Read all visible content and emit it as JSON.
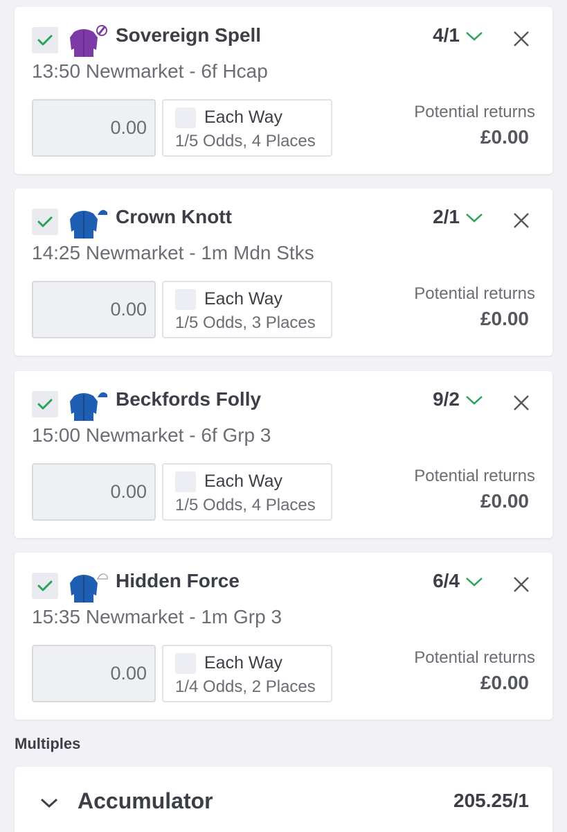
{
  "colors": {
    "accent_green": "#2aa35a",
    "silk_purple": "#7d3aa6",
    "silk_blue": "#1f5fb3"
  },
  "selections": [
    {
      "name": "Sovereign Spell",
      "odds": "4/1",
      "race": "13:50 Newmarket - 6f Hcap",
      "stake": "0.00",
      "each_way_label": "Each Way",
      "each_way_terms": "1/5 Odds, 4 Places",
      "returns_label": "Potential returns",
      "returns_value": "£0.00",
      "silk": "purple-silk-icon",
      "checked": true
    },
    {
      "name": "Crown Knott",
      "odds": "2/1",
      "race": "14:25 Newmarket - 1m Mdn Stks",
      "stake": "0.00",
      "each_way_label": "Each Way",
      "each_way_terms": "1/5 Odds, 3 Places",
      "returns_label": "Potential returns",
      "returns_value": "£0.00",
      "silk": "blue-silk-icon",
      "checked": true
    },
    {
      "name": "Beckfords Folly",
      "odds": "9/2",
      "race": "15:00 Newmarket - 6f Grp 3",
      "stake": "0.00",
      "each_way_label": "Each Way",
      "each_way_terms": "1/5 Odds, 4 Places",
      "returns_label": "Potential returns",
      "returns_value": "£0.00",
      "silk": "blue-silk-icon",
      "checked": true
    },
    {
      "name": "Hidden Force",
      "odds": "6/4",
      "race": "15:35 Newmarket - 1m Grp 3",
      "stake": "0.00",
      "each_way_label": "Each Way",
      "each_way_terms": "1/4 Odds, 2 Places",
      "returns_label": "Potential returns",
      "returns_value": "£0.00",
      "silk": "blue-white-cap-silk-icon",
      "checked": true
    }
  ],
  "multiples": {
    "section_label": "Multiples",
    "accumulator": {
      "title": "Accumulator",
      "odds": "205.25/1"
    }
  }
}
